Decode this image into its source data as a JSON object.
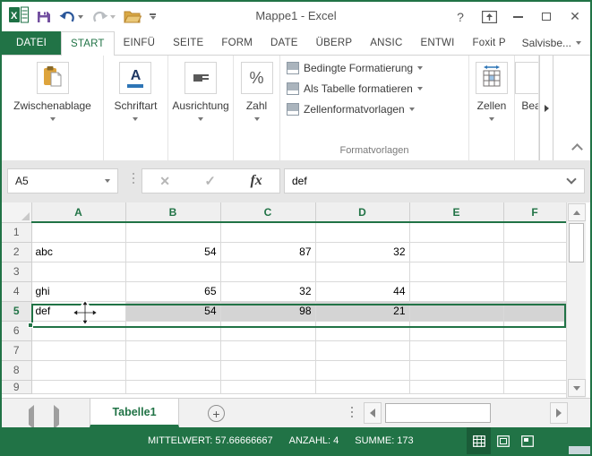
{
  "titlebar": {
    "title": "Mappe1 - Excel",
    "help_glyph": "?"
  },
  "ribbon": {
    "tabs": [
      "DATEI",
      "START",
      "EINFÜ",
      "SEITE",
      "FORM",
      "DATE",
      "ÜBERP",
      "ANSIC",
      "ENTWI",
      "Foxit P"
    ],
    "user_name": "Salvisbe...",
    "groups": {
      "clipboard_label": "Zwischenablage",
      "font_label": "Schriftart",
      "font_letter": "A",
      "alignment_label": "Ausrichtung",
      "number_label": "Zahl",
      "percent_glyph": "%",
      "styles_buttons": [
        "Bedingte Formatierung",
        "Als Tabelle formatieren",
        "Zellenformatvorlagen"
      ],
      "styles_group_label": "Formatvorlagen",
      "cells_label": "Zellen",
      "editing_label": "Bea"
    }
  },
  "formula_bar": {
    "name_box_value": "A5",
    "cancel_glyph": "✕",
    "enter_glyph": "✓",
    "fx_glyph": "fx",
    "value": "def"
  },
  "grid": {
    "columns": [
      "A",
      "B",
      "C",
      "D",
      "E",
      "F"
    ],
    "active_cell": "A5",
    "rows": [
      {
        "n": "1",
        "cells": [
          "",
          "",
          "",
          "",
          "",
          ""
        ]
      },
      {
        "n": "2",
        "cells": [
          "abc",
          "54",
          "87",
          "32",
          "",
          ""
        ]
      },
      {
        "n": "3",
        "cells": [
          "",
          "",
          "",
          "",
          "",
          ""
        ]
      },
      {
        "n": "4",
        "cells": [
          "ghi",
          "65",
          "32",
          "44",
          "",
          ""
        ]
      },
      {
        "n": "5",
        "cells": [
          "def",
          "54",
          "98",
          "21",
          "",
          ""
        ],
        "selected": true
      },
      {
        "n": "6",
        "cells": [
          "",
          "",
          "",
          "",
          "",
          ""
        ]
      },
      {
        "n": "7",
        "cells": [
          "",
          "",
          "",
          "",
          "",
          ""
        ]
      },
      {
        "n": "8",
        "cells": [
          "",
          "",
          "",
          "",
          "",
          ""
        ]
      },
      {
        "n": "9",
        "cells": [
          "",
          "",
          "",
          "",
          "",
          ""
        ],
        "partial": true
      }
    ]
  },
  "sheet_bar": {
    "active_tab": "Tabelle1",
    "add_glyph": "+"
  },
  "status_bar": {
    "mittelwert": "MITTELWERT: 57.66666667",
    "anzahl": "ANZAHL: 4",
    "summe": "SUMME: 173"
  },
  "colors": {
    "accent_green": "#217346",
    "selection_gray": "#d4d4d4",
    "status_green": "#217346"
  }
}
